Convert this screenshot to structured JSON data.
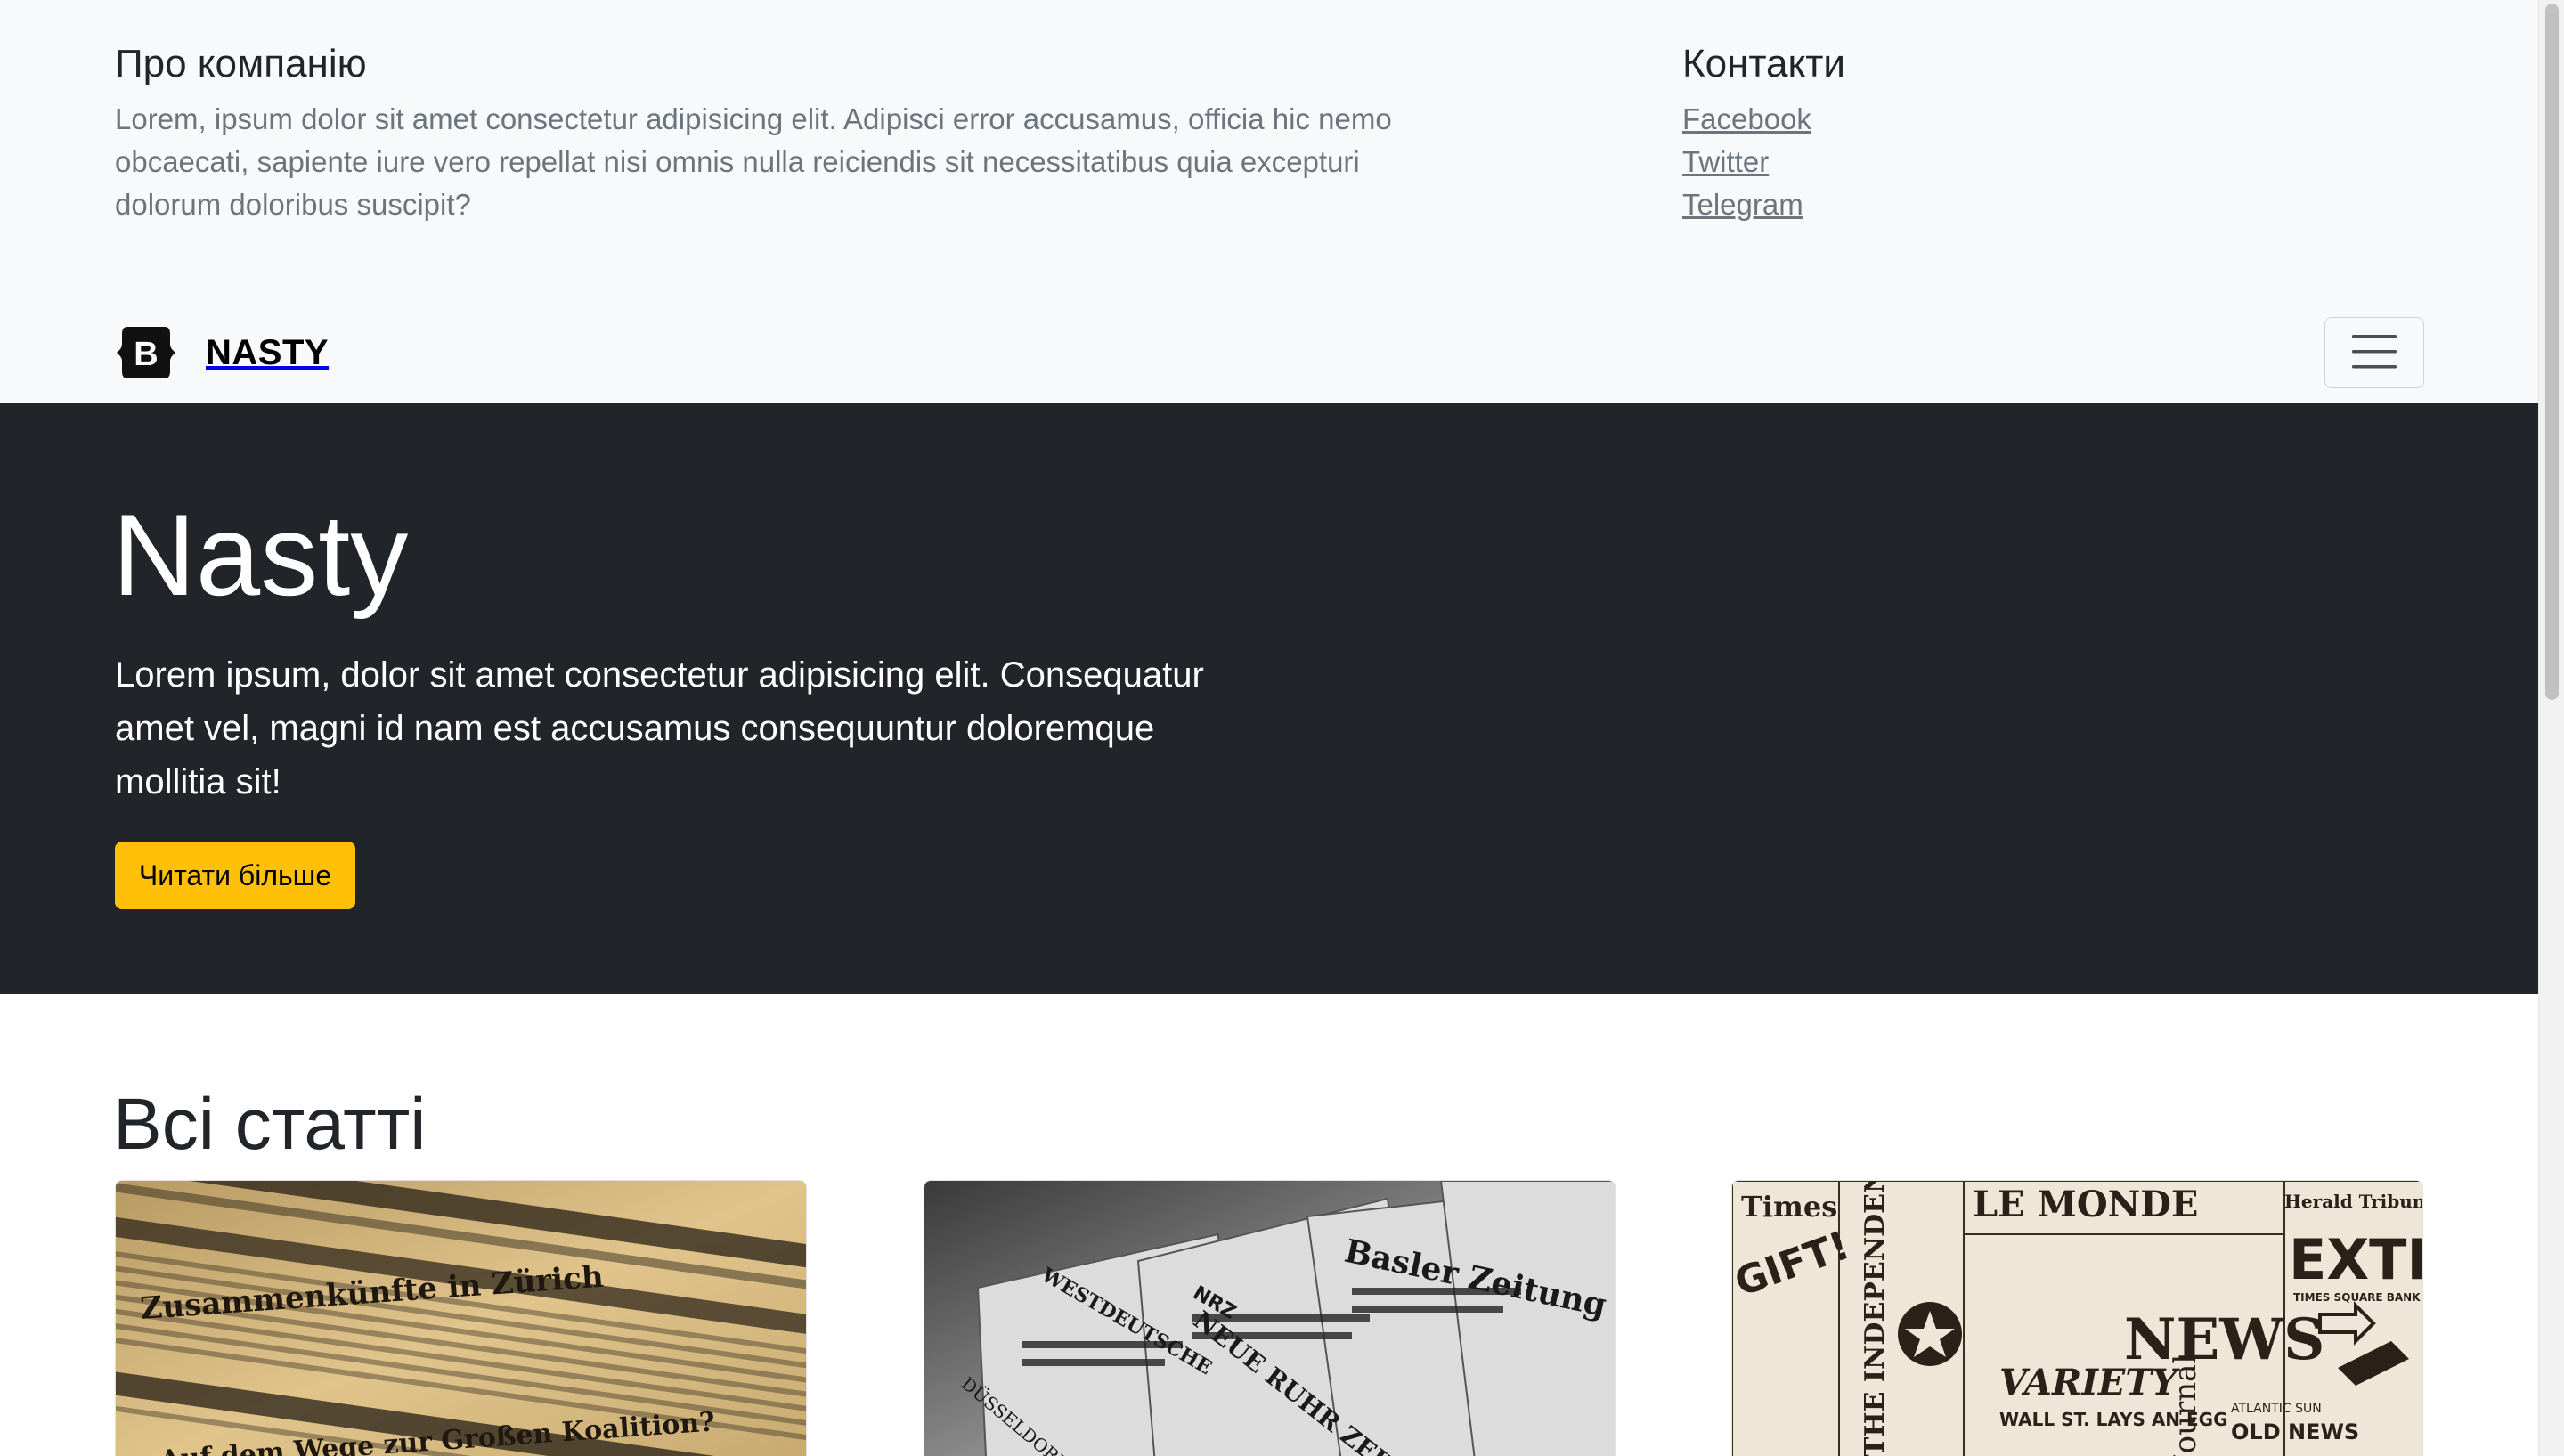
{
  "about": {
    "title": "Про компанію",
    "text": "Lorem, ipsum dolor sit amet consectetur adipisicing elit. Adipisci error accusamus, officia hic nemo obcaecati, sapiente iure vero repellat nisi omnis nulla reiciendis sit necessitatibus quia excepturi dolorum doloribus suscipit?"
  },
  "contacts": {
    "title": "Контакти",
    "links": [
      "Facebook",
      "Twitter",
      "Telegram"
    ]
  },
  "navbar": {
    "brand": "NASTY",
    "logo_letter": "B",
    "toggler_icon": "hamburger-menu-icon"
  },
  "hero": {
    "title": "Nasty",
    "text": "Lorem ipsum, dolor sit amet consectetur adipisicing elit. Consequatur amet vel, magni id nam est accusamus consequuntur doloremque mollitia sit!",
    "button_label": "Читати більше"
  },
  "articles": {
    "title": "Всі статті",
    "cards": [
      {
        "image_text": [
          "Auf dem Wege zur Großen Koalition?",
          "Zusammenkünfte in Zürich"
        ]
      },
      {
        "image_text": [
          "Basler Zeitung",
          "NEUE RUHR ZEITUNG",
          "WESTDEUTSCHE",
          "DÜSSELDORF",
          "NRZ"
        ]
      },
      {
        "image_text": [
          "LE MONDE",
          "EXTRA",
          "NEWS",
          "VARIETY",
          "WALL ST. LAYS AN EGG",
          "OLD NEWS",
          "THE INDEPENDENT",
          "Times",
          "Herald Tribune",
          "GIFT!",
          "TIMES SQUARE BANK HEIST",
          "ATLANTIC SUN",
          "Journal"
        ]
      }
    ]
  },
  "colors": {
    "hero_bg": "#212529",
    "accent": "#ffc107",
    "top_bg": "#f8f9fa"
  }
}
